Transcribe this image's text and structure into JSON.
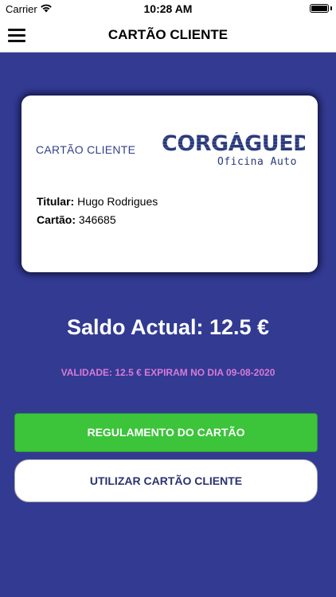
{
  "status_bar": {
    "carrier": "Carrier",
    "time": "10:28 AM"
  },
  "nav": {
    "title": "CARTÃO CLIENTE",
    "menu_icon": "hamburger-menu-icon"
  },
  "card": {
    "label": "CARTÃO CLIENTE",
    "logo_main": "CORGÁGUEDA",
    "logo_sub": "Oficina Auto",
    "holder_label": "Titular:",
    "holder_value": "Hugo Rodrigues",
    "number_label": "Cartão:",
    "number_value": "346685"
  },
  "balance": "Saldo Actual: 12.5 €",
  "validity": "VALIDADE: 12.5 € EXPIRAM NO DIA 09-08-2020",
  "buttons": {
    "rules": "REGULAMENTO DO CARTÃO",
    "use": "UTILIZAR CARTÃO CLIENTE"
  },
  "colors": {
    "background": "#323a92",
    "accent_green": "#3cc43a",
    "validity_pink": "#d87ad8"
  }
}
